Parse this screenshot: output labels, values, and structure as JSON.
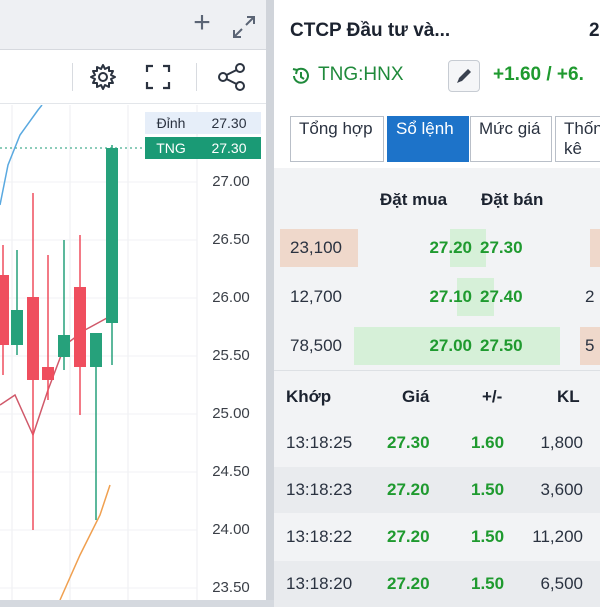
{
  "chart": {
    "price_labels": [
      "27.00",
      "26.50",
      "26.00",
      "25.50",
      "25.00",
      "24.50",
      "24.00",
      "23.50"
    ],
    "high_label": "Đỉnh",
    "high_value": "27.30",
    "ticker_label": "TNG",
    "ticker_value": "27.30",
    "up_color": "#26a17b",
    "down_color": "#ef4e5e"
  },
  "header": {
    "company_name": "CTCP Đầu tư và...",
    "head_number": "2",
    "ticker": "TNG:HNX",
    "change": "+1.60 / +6."
  },
  "tabs": [
    {
      "label": "Tổng hợp",
      "active": false
    },
    {
      "label": "Sổ lệnh",
      "active": true
    },
    {
      "label": "Mức giá",
      "active": false
    },
    {
      "label": "Thống kê",
      "active": false
    }
  ],
  "order_book": {
    "bid_header": "Đặt mua",
    "ask_header": "Đặt bán",
    "rows": [
      {
        "volume": "23,100",
        "bid": "27.20",
        "ask": "27.30",
        "edge": ""
      },
      {
        "volume": "12,700",
        "bid": "27.10",
        "ask": "27.40",
        "edge": "2"
      },
      {
        "volume": "78,500",
        "bid": "27.00",
        "ask": "27.50",
        "edge": "5"
      }
    ]
  },
  "matches": {
    "headers": {
      "time": "Khớp",
      "price": "Giá",
      "change": "+/-",
      "volume": "KL"
    },
    "rows": [
      {
        "time": "13:18:25",
        "price": "27.30",
        "change": "1.60",
        "volume": "1,800"
      },
      {
        "time": "13:18:23",
        "price": "27.20",
        "change": "1.50",
        "volume": "3,600"
      },
      {
        "time": "13:18:22",
        "price": "27.20",
        "change": "1.50",
        "volume": "11,200"
      },
      {
        "time": "13:18:20",
        "price": "27.20",
        "change": "1.50",
        "volume": "6,500"
      }
    ]
  }
}
